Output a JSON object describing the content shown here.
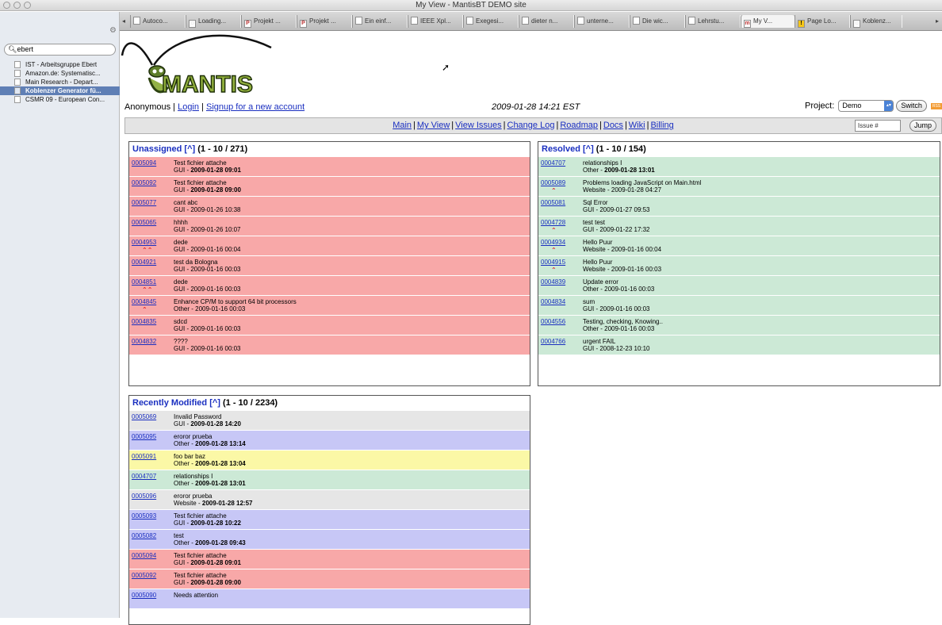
{
  "window": {
    "title": "My View - MantisBT DEMO site"
  },
  "sidebar": {
    "search_value": "ebert",
    "items": [
      {
        "label": "IST - Arbeitsgruppe Ebert",
        "selected": false
      },
      {
        "label": "Amazon.de: Systematisc...",
        "selected": false
      },
      {
        "label": "Main Research - Depart...",
        "selected": false
      },
      {
        "label": "Koblenzer Generator fü...",
        "selected": true
      },
      {
        "label": "CSMR 09 - European Con...",
        "selected": false
      }
    ]
  },
  "tabs": [
    {
      "label": "Autoco...",
      "icon": "page-icon"
    },
    {
      "label": "Loading...",
      "icon": "loading-icon"
    },
    {
      "label": "Projekt ...",
      "icon": "p-icon"
    },
    {
      "label": "Projekt ...",
      "icon": "p-icon"
    },
    {
      "label": "Ein einf...",
      "icon": "page-icon"
    },
    {
      "label": "IEEE Xpl...",
      "icon": "page-icon"
    },
    {
      "label": "Exegesi...",
      "icon": "page-icon"
    },
    {
      "label": "dieter n...",
      "icon": "page-icon"
    },
    {
      "label": "unterne...",
      "icon": "page-icon"
    },
    {
      "label": "Die wic...",
      "icon": "page-icon"
    },
    {
      "label": "Lehrstu...",
      "icon": "page-icon"
    },
    {
      "label": "My V...",
      "icon": "mantis-icon"
    },
    {
      "label": "Page Lo...",
      "icon": "warning-icon"
    },
    {
      "label": "Koblenz...",
      "icon": "loading-icon"
    }
  ],
  "header": {
    "logo_text": "MANTIS",
    "user": {
      "name": "Anonymous",
      "login": "Login",
      "signup": "Signup for a new account"
    },
    "datetime": "2009-01-28 14:21 EST",
    "project_label": "Project:",
    "project_value": "Demo",
    "switch_label": "Switch",
    "rss_label": "RSS"
  },
  "menu": {
    "items": [
      "Main",
      "My View",
      "View Issues",
      "Change Log",
      "Roadmap",
      "Docs",
      "Wiki",
      "Billing"
    ],
    "issue_placeholder": "Issue #",
    "jump_label": "Jump"
  },
  "colors": {
    "assigned_red": "#f8a8a8",
    "resolved_green": "#cce9d6",
    "closed_gray": "#e6e6e6",
    "feedback_purple": "#c7c7f6",
    "confirmed_yellow": "#fbf8a6",
    "link": "#1a2fc0"
  },
  "boxes": {
    "unassigned": {
      "title": "Unassigned",
      "caret": "[^]",
      "range": "(1 - 10 / 271)",
      "rows": [
        {
          "id": "0005094",
          "summary": "Test fichier attache",
          "category": "GUI",
          "date": "2009-01-28 09:01",
          "bold": true,
          "prio": "",
          "color": "#f8a8a8"
        },
        {
          "id": "0005092",
          "summary": "Test fichier attache",
          "category": "GUI",
          "date": "2009-01-28 09:00",
          "bold": true,
          "prio": "",
          "color": "#f8a8a8"
        },
        {
          "id": "0005077",
          "summary": "cant abc",
          "category": "GUI",
          "date": "2009-01-26 10:38",
          "bold": false,
          "prio": "",
          "color": "#f8a8a8"
        },
        {
          "id": "0005065",
          "summary": "hhhh",
          "category": "GUI",
          "date": "2009-01-26 10:07",
          "bold": false,
          "prio": "",
          "color": "#f8a8a8"
        },
        {
          "id": "0004953",
          "summary": "dede",
          "category": "GUI",
          "date": "2009-01-16 00:04",
          "bold": false,
          "prio": "⌃⌃",
          "color": "#f8a8a8"
        },
        {
          "id": "0004921",
          "summary": "test da Bologna",
          "category": "GUI",
          "date": "2009-01-16 00:03",
          "bold": false,
          "prio": "",
          "color": "#f8a8a8"
        },
        {
          "id": "0004851",
          "summary": "dede",
          "category": "GUI",
          "date": "2009-01-16 00:03",
          "bold": false,
          "prio": "⌃⌃",
          "color": "#f8a8a8"
        },
        {
          "id": "0004845",
          "summary": "Enhance CP/M to support 64 bit processors",
          "category": "Other",
          "date": "2009-01-16 00:03",
          "bold": false,
          "prio": "⌃",
          "color": "#f8a8a8"
        },
        {
          "id": "0004835",
          "summary": "sdcd",
          "category": "GUI",
          "date": "2009-01-16 00:03",
          "bold": false,
          "prio": "",
          "color": "#f8a8a8"
        },
        {
          "id": "0004832",
          "summary": "????",
          "category": "GUI",
          "date": "2009-01-16 00:03",
          "bold": false,
          "prio": "",
          "color": "#f8a8a8"
        }
      ]
    },
    "resolved": {
      "title": "Resolved",
      "caret": "[^]",
      "range": "(1 - 10 / 154)",
      "rows": [
        {
          "id": "0004707",
          "summary": "relationships I",
          "category": "Other",
          "date": "2009-01-28 13:01",
          "bold": true,
          "prio": "",
          "color": "#cce9d6"
        },
        {
          "id": "0005089",
          "summary": "Problems loading JavaScript on Main.html",
          "category": "Website",
          "date": "2009-01-28 04:27",
          "bold": false,
          "prio": "⌃",
          "color": "#cce9d6"
        },
        {
          "id": "0005081",
          "summary": "Sql Error",
          "category": "GUI",
          "date": "2009-01-27 09:53",
          "bold": false,
          "prio": "",
          "color": "#cce9d6"
        },
        {
          "id": "0004728",
          "summary": "test test",
          "category": "GUI",
          "date": "2009-01-22 17:32",
          "bold": false,
          "prio": "⌃",
          "color": "#cce9d6"
        },
        {
          "id": "0004934",
          "summary": "Hello Puur",
          "category": "Website",
          "date": "2009-01-16 00:04",
          "bold": false,
          "prio": "⌃",
          "color": "#cce9d6"
        },
        {
          "id": "0004915",
          "summary": "Hello Puur",
          "category": "Website",
          "date": "2009-01-16 00:03",
          "bold": false,
          "prio": "⌃",
          "color": "#cce9d6"
        },
        {
          "id": "0004839",
          "summary": "Update error",
          "category": "Other",
          "date": "2009-01-16 00:03",
          "bold": false,
          "prio": "",
          "color": "#cce9d6"
        },
        {
          "id": "0004834",
          "summary": "sum",
          "category": "GUI",
          "date": "2009-01-16 00:03",
          "bold": false,
          "prio": "",
          "color": "#cce9d6"
        },
        {
          "id": "0004556",
          "summary": "Testing, checking, Knowing..",
          "category": "Other",
          "date": "2009-01-16 00:03",
          "bold": false,
          "prio": "",
          "color": "#cce9d6"
        },
        {
          "id": "0004766",
          "summary": "urgent FAIL",
          "category": "GUI",
          "date": "2008-12-23 10:10",
          "bold": false,
          "prio": "",
          "color": "#cce9d6"
        }
      ]
    },
    "recent": {
      "title": "Recently Modified",
      "caret": "[^]",
      "range": "(1 - 10 / 2234)",
      "rows": [
        {
          "id": "0005069",
          "summary": "Invalid Password",
          "category": "GUI",
          "date": "2009-01-28 14:20",
          "bold": true,
          "prio": "",
          "color": "#e6e6e6"
        },
        {
          "id": "0005095",
          "summary": "eroror prueba",
          "category": "Other",
          "date": "2009-01-28 13:14",
          "bold": true,
          "prio": "",
          "color": "#c7c7f6"
        },
        {
          "id": "0005091",
          "summary": "foo bar baz",
          "category": "Other",
          "date": "2009-01-28 13:04",
          "bold": true,
          "prio": "",
          "color": "#fbf8a6"
        },
        {
          "id": "0004707",
          "summary": "relationships I",
          "category": "Other",
          "date": "2009-01-28 13:01",
          "bold": true,
          "prio": "",
          "color": "#cce9d6"
        },
        {
          "id": "0005096",
          "summary": "eroror prueba",
          "category": "Website",
          "date": "2009-01-28 12:57",
          "bold": true,
          "prio": "",
          "color": "#e6e6e6"
        },
        {
          "id": "0005093",
          "summary": "Test fichier attache",
          "category": "GUI",
          "date": "2009-01-28 10:22",
          "bold": true,
          "prio": "",
          "color": "#c7c7f6"
        },
        {
          "id": "0005082",
          "summary": "test",
          "category": "Other",
          "date": "2009-01-28 09:43",
          "bold": true,
          "prio": "",
          "color": "#c7c7f6"
        },
        {
          "id": "0005094",
          "summary": "Test fichier attache",
          "category": "GUI",
          "date": "2009-01-28 09:01",
          "bold": true,
          "prio": "",
          "color": "#f8a8a8"
        },
        {
          "id": "0005092",
          "summary": "Test fichier attache",
          "category": "GUI",
          "date": "2009-01-28 09:00",
          "bold": true,
          "prio": "",
          "color": "#f8a8a8"
        },
        {
          "id": "0005090",
          "summary": "Needs attention",
          "category": "",
          "date": "",
          "bold": false,
          "prio": "",
          "color": "#c7c7f6"
        }
      ]
    }
  }
}
